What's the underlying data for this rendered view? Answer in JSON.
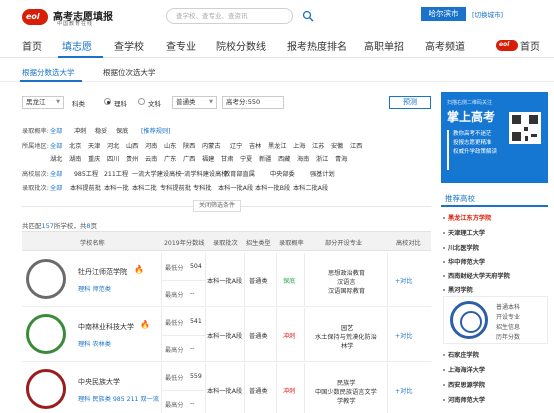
{
  "header": {
    "logo_mark": "eol",
    "logo_title": "高考志愿填报",
    "logo_sub": "中国教育在线",
    "search_placeholder": "查学校、查专业、查资讯",
    "city": "哈尔滨市",
    "city_switch": "[切换城市]"
  },
  "nav": {
    "items": [
      "首页",
      "填志愿",
      "查学校",
      "查专业",
      "院校分数线",
      "报考热度排名",
      "高职单招",
      "高考频道"
    ],
    "home_label": "首页"
  },
  "subtabs": [
    "根据分数选大学",
    "根据位次选大学"
  ],
  "form": {
    "province": "黑龙江",
    "subject_label": "科类",
    "subject_options": [
      "理科",
      "文科"
    ],
    "batch": "普通类",
    "score": "高考分:550",
    "predict_button": "预测"
  },
  "filters": [
    {
      "label": "录取概率:",
      "options": [
        "全部",
        "冲刺",
        "稳妥",
        "保底",
        "[推荐规则]"
      ],
      "selected": 0
    },
    {
      "label": "所属地区:",
      "options": [
        "全部",
        "北京",
        "天津",
        "河北",
        "山西",
        "河南",
        "山东",
        "陕西",
        "内蒙古",
        "辽宁",
        "吉林",
        "黑龙江",
        "上海",
        "江苏",
        "安徽",
        "江西"
      ],
      "selected": 0
    },
    {
      "label": "",
      "options": [
        "湖北",
        "湖南",
        "重庆",
        "四川",
        "贵州",
        "云南",
        "广东",
        "广西",
        "福建",
        "甘肃",
        "宁夏",
        "新疆",
        "西藏",
        "海南",
        "浙江",
        "青海"
      ],
      "selected": -1
    },
    {
      "label": "高校层次:",
      "options": [
        "全部",
        "985工程",
        "211工程",
        "一流大学建设高校",
        "一流学科建设高校",
        "教育部直属",
        "中央部委",
        "强基计划"
      ],
      "selected": 0
    },
    {
      "label": "录取批次:",
      "options": [
        "全部",
        "本科提前批",
        "本科一批",
        "本科二批",
        "专科提前批",
        "专科批",
        "本科一批A段",
        "本科一批B段",
        "本科二批A段"
      ],
      "selected": 0
    }
  ],
  "collapse_label": "关闭筛选条件",
  "summary": {
    "prefix": "共匹配",
    "count": "157",
    "mid": "所学校，共",
    "pages": "8",
    "suffix": "页"
  },
  "table": {
    "headers": [
      "学校名称",
      "2019年分数线",
      "录取批次",
      "招生类型",
      "录取概率",
      "部分开设专业",
      "高校对比"
    ],
    "rows": [
      {
        "name": "牡丹江师范学院",
        "tags": "理科  师范类",
        "low_label": "最低分",
        "low": "504",
        "high_label": "最高分",
        "high": "--",
        "batch": "本科一批A段",
        "type": "普通类",
        "prob": "保底",
        "majors": [
          "思想政治教育",
          "汉语言",
          "汉语国际教育"
        ],
        "compare": "+对比"
      },
      {
        "name": "中南林业科技大学",
        "tags": "理科  农林类",
        "low_label": "最低分",
        "low": "541",
        "high_label": "最高分",
        "high": "--",
        "batch": "本科一批A段",
        "type": "普通类",
        "prob": "冲刺",
        "majors": [
          "园艺",
          "水土保持与荒漠化防治",
          "林学"
        ],
        "compare": "+对比"
      },
      {
        "name": "中央民族大学",
        "tags": "理科  民族类  985  211  双一流",
        "low_label": "最低分",
        "low": "559",
        "high_label": "最高分",
        "high": "--",
        "batch": "本科一批A段",
        "type": "普通类",
        "prob": "冲刺",
        "majors": [
          "民族学",
          "中国少数民族语言文学",
          "学教学"
        ],
        "compare": "+对比"
      }
    ]
  },
  "ad": {
    "line1": "扫描右侧二维码关注",
    "line2": "掌上高考",
    "line3": [
      "教你高考不迷茫",
      "投报志愿更精准",
      "权威升学政策解读"
    ]
  },
  "recommend": {
    "title": "推荐高校",
    "items_top": [
      "黑龙江东方学院",
      "天津理工大学",
      "川北医学院",
      "华中师范大学",
      "西南财经大学天府学院",
      "黑河学院"
    ],
    "card_lines": [
      "普通本科",
      "开设专业",
      "招生信息",
      "历年分数"
    ],
    "items_bottom": [
      "石家庄学院",
      "上海海洋大学",
      "西安思源学院",
      "河南师范大学"
    ]
  },
  "colors": {
    "accent": "#1a73c9",
    "brand_red": "#d81e06",
    "hot": "#e02020",
    "safe": "#2ea44f"
  }
}
